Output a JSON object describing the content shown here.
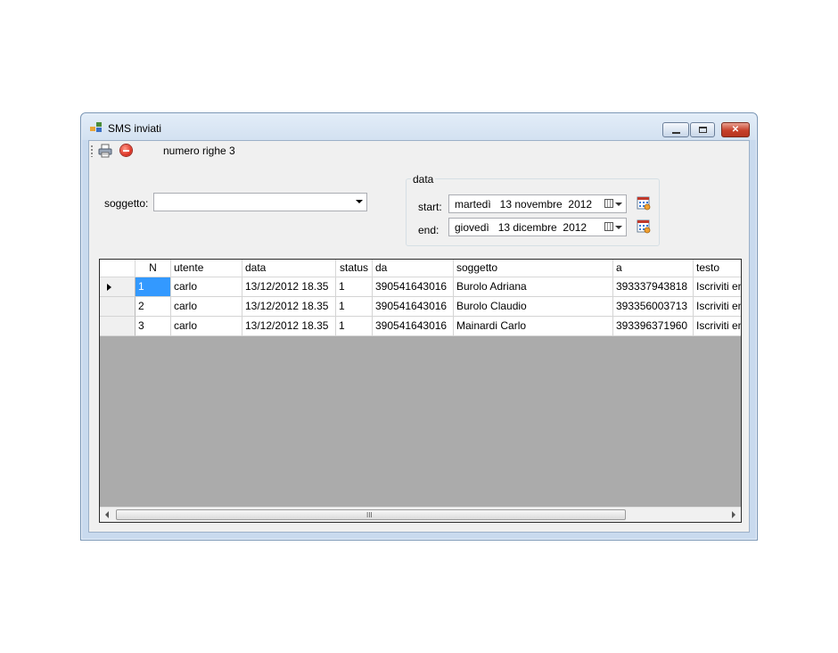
{
  "window": {
    "title": "SMS inviati",
    "buttons": {
      "minimize": "minimize",
      "maximize": "maximize",
      "close": "✕"
    }
  },
  "toolbar": {
    "row_count_label": "numero righe 3",
    "print_icon": "printer-icon",
    "stop_icon": "stop-icon"
  },
  "filters": {
    "soggetto_label": "soggetto:",
    "soggetto_value": "",
    "date_group_title": "data",
    "start_label": "start:",
    "start_value": "martedì   13 novembre  2012",
    "end_label": "end:",
    "end_value": "giovedì   13 dicembre  2012"
  },
  "grid": {
    "columns": [
      "N",
      "utente",
      "data",
      "status",
      "da",
      "soggetto",
      "a",
      "testo"
    ],
    "rows": [
      [
        "1",
        "carlo",
        "13/12/2012 18.35",
        "1",
        "390541643016",
        "Burolo Adriana",
        "393337943818",
        "Iscriviti ent"
      ],
      [
        "2",
        "carlo",
        "13/12/2012 18.35",
        "1",
        "390541643016",
        "Burolo Claudio",
        "393356003713",
        "Iscriviti ent"
      ],
      [
        "3",
        "carlo",
        "13/12/2012 18.35",
        "1",
        "390541643016",
        "Mainardi Carlo",
        "393396371960",
        "Iscriviti ent"
      ]
    ],
    "scroll_grip": "III"
  },
  "colors": {
    "selection": "#3399ff",
    "grid_background": "#ababab",
    "close_button": "#c6402a"
  }
}
